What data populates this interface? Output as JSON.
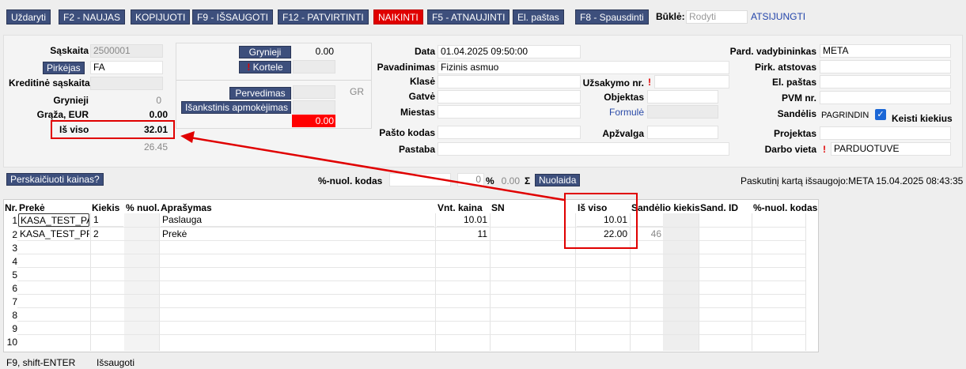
{
  "toolbar": {
    "buttons": [
      "Uždaryti",
      "F2 - NAUJAS",
      "KOPIJUOTI",
      "F9 - IŠSAUGOTI",
      "F12 - PATVIRTINTI",
      "NAIKINTI",
      "F5 - ATNAUJINTI",
      "El. paštas",
      "F8 - Spausdinti"
    ],
    "status_label": "Būklė:",
    "status_placeholder": "Rodyti",
    "disconnect_link": "ATSIJUNGTI",
    "colors": {
      "button": "#3d4f7c",
      "danger": "#e00000"
    }
  },
  "left": {
    "saskaita_label": "Sąskaita",
    "saskaita_value": "2500001",
    "pirkejas_button": "Pirkėjas",
    "pirkejas_value": "FA",
    "kreditine_label": "Kreditinė sąskaita",
    "grynieji_label": "Grynieji",
    "grynieji_value": "0",
    "graza_label": "Grąža, EUR",
    "graza_value": "0.00",
    "is_viso_label": "Iš viso",
    "is_viso_value": "32.01",
    "subtotal": "26.45"
  },
  "payment": {
    "grynieji_button": "Grynieji",
    "grynieji_value": "0.00",
    "kortele_button": "Kortele",
    "pervedimas_button": "Pervedimas",
    "gr_label": "GR",
    "isankstinis_button": "Išankstinis apmokėjimas",
    "balance_value": "0.00"
  },
  "middle": {
    "data_label": "Data",
    "data_value": "01.04.2025 09:50:00",
    "pavadinimas_label": "Pavadinimas",
    "pavadinimas_value": "Fizinis asmuo",
    "klase_label": "Klasė",
    "uzsakymo_label": "Užsakymo nr.",
    "gatve_label": "Gatvė",
    "objektas_label": "Objektas",
    "miestas_label": "Miestas",
    "formule_link": "Formulė",
    "pasto_label": "Pašto kodas",
    "apzvalga_label": "Apžvalga",
    "pastaba_label": "Pastaba"
  },
  "right": {
    "vadybininkas_label": "Pard. vadybininkas",
    "vadybininkas_value": "META",
    "atstovas_label": "Pirk. atstovas",
    "el_pastas_label": "El. paštas",
    "pvm_label": "PVM nr.",
    "sandelis_label": "Sandėlis",
    "sandelis_value": "PAGRINDIN",
    "keisti_label": "Keisti kiekius",
    "projektas_label": "Projektas",
    "darbo_label": "Darbo vieta",
    "darbo_value": "PARDUOTUVE"
  },
  "discount": {
    "recalc_button": "Perskaičiuoti kainas?",
    "nuol_label": "%-nuol. kodas",
    "pct_value": "0",
    "pct_sign": "%",
    "amount_value": "0.00",
    "sigma": "Σ",
    "nuolaida_button": "Nuolaida",
    "last_saved": "Paskutinį kartą išsaugojo:META 15.04.2025 08:43:35"
  },
  "grid": {
    "headers": [
      "Nr.",
      "Prekė",
      "Kiekis",
      "% nuol.",
      "Aprašymas",
      "Vnt. kaina",
      "SN",
      "Iš viso",
      "Sandėlio kiekis",
      "Sand. ID",
      "%-nuol. kodas"
    ],
    "row_numbers": [
      "1",
      "2",
      "3",
      "4",
      "5",
      "6",
      "7",
      "8",
      "9",
      "10"
    ],
    "rows": [
      {
        "preke": "KASA_TEST_PA",
        "kiekis": "1",
        "aprasymas": "Paslauga",
        "kaina": "10.01",
        "is_viso": "10.01",
        "sandelio": ""
      },
      {
        "preke": "KASA_TEST_PR",
        "kiekis": "2",
        "aprasymas": "Prekė",
        "kaina": "11",
        "is_viso": "22.00",
        "sandelio": "46"
      }
    ]
  },
  "footer": {
    "shortcut": "F9, shift-ENTER",
    "saved": "Išsaugoti"
  }
}
